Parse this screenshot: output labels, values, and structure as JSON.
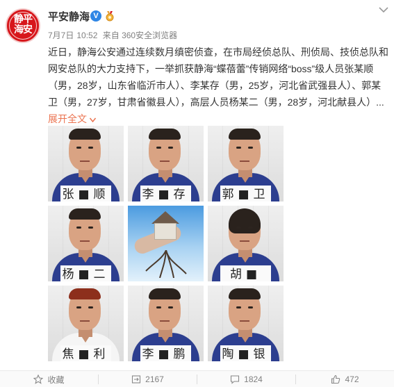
{
  "account": {
    "avatar_text_line1": "静平",
    "avatar_text_line2": "海安",
    "name": "平安静海",
    "verified_mark": "V",
    "badge_icon": "medal-icon"
  },
  "post_meta": {
    "date": "7月7日",
    "time": "10:52",
    "source": "来自 360安全浏览器"
  },
  "post": {
    "line1": "近日，静海公安通过连续数月缜密侦查，在市局经侦总队、刑侦局、技侦总队和",
    "line2": "网安总队的大力支持下，一举抓获静海“蝶蓓蕾”传销网络“boss”级人员张某顺",
    "line3": "（男，28岁，山东省临沂市人）、李某存（男，25岁，河北省武强县人）、郭某",
    "line4": "卫（男，27岁，甘肃省徽县人），高层人员杨某二（男，28岁，河北献县人）...",
    "expand_label": "展开全文",
    "expand_arrow": "c"
  },
  "photos": [
    {
      "plate": "张■顺",
      "type": "suspect",
      "hair": "normal",
      "shirt": "blue"
    },
    {
      "plate": "李■存",
      "type": "suspect",
      "hair": "normal",
      "shirt": "blue"
    },
    {
      "plate": "郭■卫",
      "type": "suspect",
      "hair": "normal",
      "shirt": "blue"
    },
    {
      "plate": "杨■二",
      "type": "suspect",
      "hair": "normal",
      "shirt": "blue"
    },
    {
      "plate": "",
      "type": "house-in-hand"
    },
    {
      "plate": "胡■",
      "type": "suspect",
      "hair": "long",
      "shirt": "blue"
    },
    {
      "plate": "焦■利",
      "type": "suspect",
      "hair": "red",
      "shirt": "white"
    },
    {
      "plate": "李■鹏",
      "type": "suspect",
      "hair": "short",
      "shirt": "blue"
    },
    {
      "plate": "陶■银",
      "type": "suspect",
      "hair": "short",
      "shirt": "blue"
    }
  ],
  "footer": {
    "favorite_label": "收藏",
    "repost_count": "2167",
    "comment_count": "1824",
    "like_count": "472"
  },
  "colors": {
    "brand_red": "#d7161b",
    "verified_blue": "#2f86e5",
    "link_orange": "#eb7350",
    "meta_grey": "#808080"
  }
}
